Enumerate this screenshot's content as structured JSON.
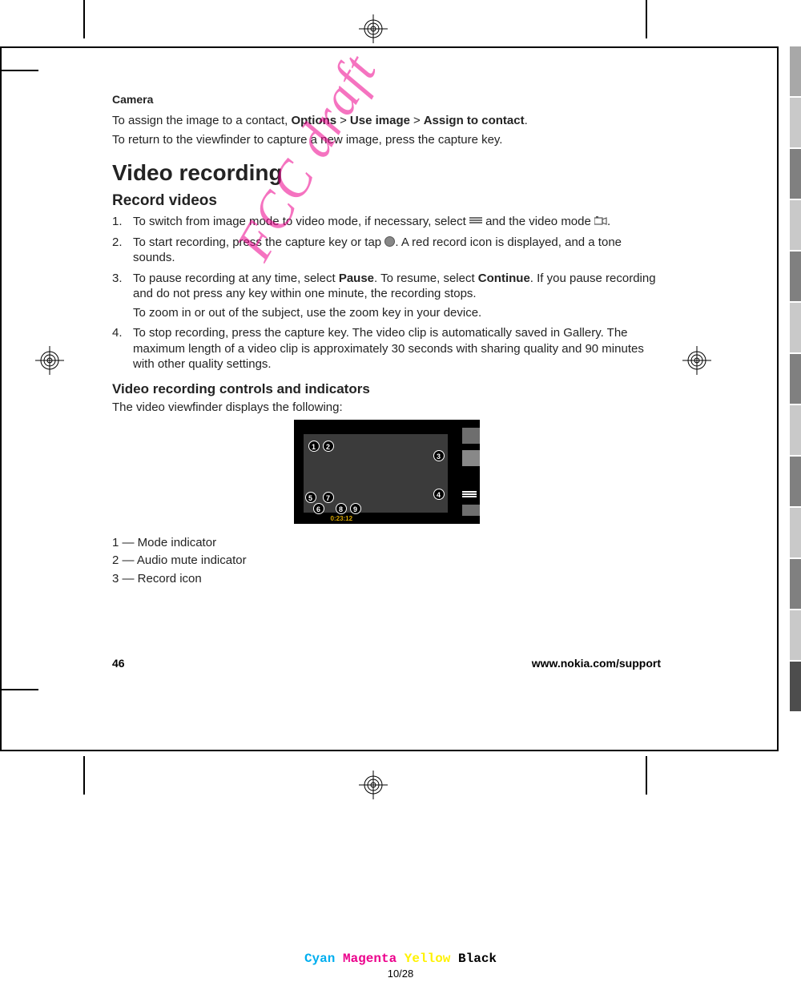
{
  "header": "Camera",
  "intro": {
    "assign_prefix": "To assign the image to a contact, ",
    "options": "Options",
    "use_image": "Use image",
    "assign_to_contact": "Assign to contact",
    "assign_suffix": ".",
    "return": "To return to the viewfinder to capture a new image, press the capture key."
  },
  "h1": "Video recording",
  "h2": "Record videos",
  "steps": {
    "s1a": "To switch from image mode to video mode, if necessary, select ",
    "s1b": " and the video mode ",
    "s1c": ".",
    "s2a": "To start recording, press the capture key or tap ",
    "s2b": ". A red record icon is displayed, and a tone sounds.",
    "s3a": "To pause recording at any time, select ",
    "s3_pause": "Pause",
    "s3b": ". To resume, select ",
    "s3_continue": "Continue",
    "s3c": ". If you pause recording and do not press any key within one minute, the recording stops.",
    "s3_sub": "To zoom in or out of the subject, use the zoom key in your device.",
    "s4": "To stop recording, press the capture key. The video clip is automatically saved in Gallery. The maximum length of a video clip is approximately 30 seconds with sharing quality and 90 minutes with other quality settings."
  },
  "h3": "Video recording controls and indicators",
  "vf_intro": "The video viewfinder displays the following:",
  "vf_timecode": "0:23:12",
  "legend": {
    "l1": "1 — Mode indicator",
    "l2": "2 — Audio mute indicator",
    "l3": "3 — Record icon"
  },
  "footer": {
    "page": "46",
    "url": "www.nokia.com/support"
  },
  "watermark": "FCC draft",
  "cmyk": {
    "c": "Cyan",
    "m": "Magenta",
    "y": "Yellow",
    "k": "Black"
  },
  "sheet": "10/28",
  "gt": ">",
  "tab_colors": [
    "#a8a8a8",
    "#c9c9c9",
    "#808080",
    "#c9c9c9",
    "#808080",
    "#c9c9c9",
    "#808080",
    "#c9c9c9",
    "#808080",
    "#c9c9c9",
    "#808080",
    "#c9c9c9",
    "#4d4d4d"
  ]
}
